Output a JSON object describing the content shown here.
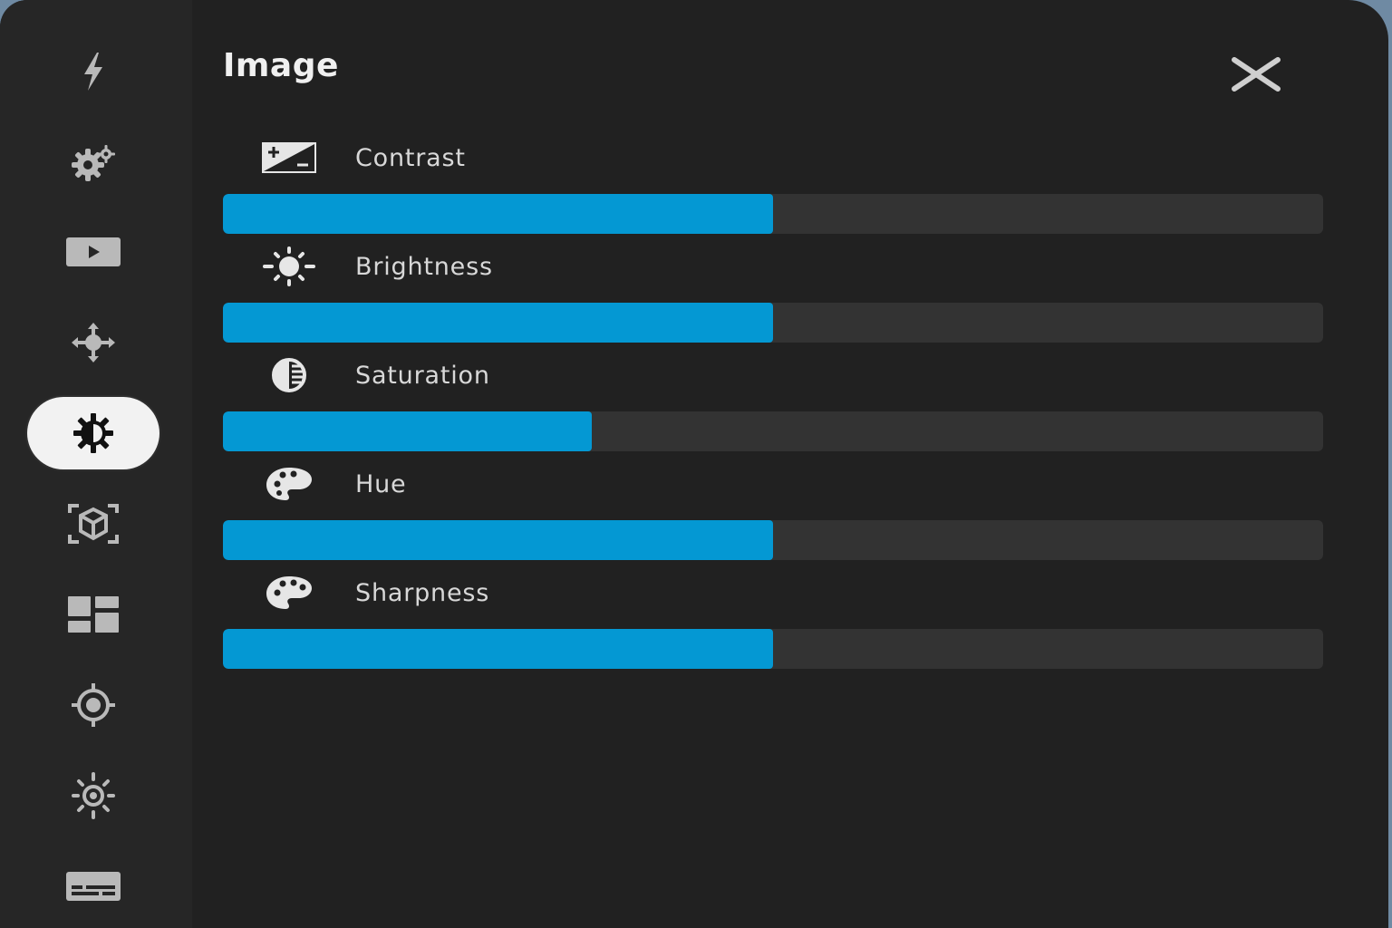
{
  "panel": {
    "title": "Image",
    "close_icon": "close-icon"
  },
  "sidebar": {
    "items": [
      {
        "icon": "lightning-icon",
        "active": false
      },
      {
        "icon": "gears-icon",
        "active": false
      },
      {
        "icon": "video-icon",
        "active": false
      },
      {
        "icon": "move-icon",
        "active": false
      },
      {
        "icon": "brightness-contrast-icon",
        "active": true
      },
      {
        "icon": "3d-cube-icon",
        "active": false
      },
      {
        "icon": "dashboard-icon",
        "active": false
      },
      {
        "icon": "target-icon",
        "active": false
      },
      {
        "icon": "light-settings-icon",
        "active": false
      },
      {
        "icon": "subtitles-icon",
        "active": false
      }
    ]
  },
  "controls": [
    {
      "label": "Contrast",
      "icon": "contrast-icon",
      "value_percent": 50
    },
    {
      "label": "Brightness",
      "icon": "sun-icon",
      "value_percent": 50
    },
    {
      "label": "Saturation",
      "icon": "saturation-icon",
      "value_percent": 33.5
    },
    {
      "label": "Hue",
      "icon": "palette-icon",
      "value_percent": 50
    },
    {
      "label": "Sharpness",
      "icon": "palette-icon",
      "value_percent": 50
    }
  ],
  "colors": {
    "accent": "#0498d3",
    "track": "#333333",
    "panel_bg": "#212121",
    "sidebar_bg": "#262626"
  }
}
